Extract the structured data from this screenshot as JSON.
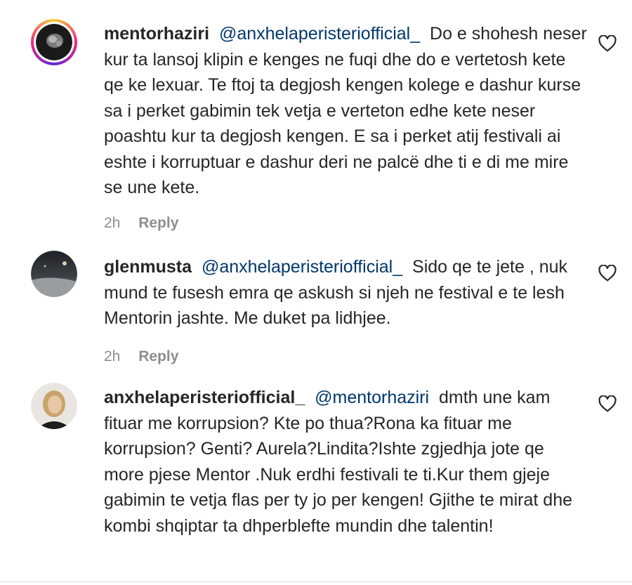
{
  "comments": [
    {
      "username": "mentorhaziri",
      "mention": "@anxhelaperisteriofficial_",
      "text": "Do e shohesh neser kur ta lansoj klipin e kenges ne fuqi dhe do e vertetosh kete qe ke lexuar. Te ftoj ta degjosh kengen kolege e dashur kurse sa i perket gabimin tek vetja e verteton edhe kete neser poashtu kur ta degjosh kengen. E sa i perket atij festivali ai eshte i korruptuar e dashur deri ne palcë dhe ti e di me mire se une kete.",
      "time": "2h",
      "reply_label": "Reply",
      "avatar_icon": "profile-photo-story-ring"
    },
    {
      "username": "glenmusta",
      "mention": "@anxhelaperisteriofficial_",
      "text": "Sido qe te jete , nuk mund te fusesh emra qe askush si njeh ne festival e te lesh Mentorin jashte. Me duket pa lidhjee.",
      "time": "2h",
      "reply_label": "Reply",
      "avatar_icon": "profile-photo"
    },
    {
      "username": "anxhelaperisteriofficial_",
      "mention": "@mentorhaziri",
      "text": "dmth une kam fituar me korrupsion? Kte po thua?Rona ka fituar me korrupsion? Genti? Aurela?Lindita?Ishte zgjedhja jote qe more pjese Mentor .Nuk erdhi festivali te ti.Kur them gjeje gabimin te vetja flas per ty jo per kengen! Gjithe te mirat dhe kombi shqiptar ta dhperblefte mundin dhe talentin!",
      "avatar_icon": "profile-photo"
    }
  ],
  "icons": {
    "like": "heart-outline-icon"
  },
  "colors": {
    "mention": "#00376b",
    "meta": "#8e8e8e",
    "text": "#262626"
  }
}
